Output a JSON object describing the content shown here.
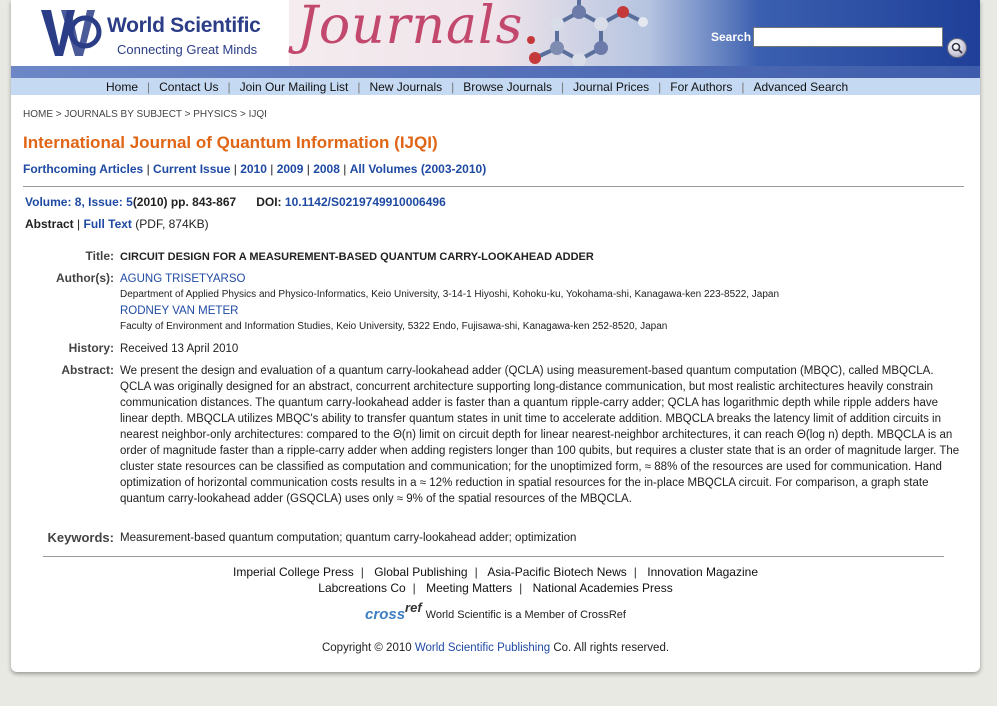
{
  "banner": {
    "logo_title": "World Scientific",
    "logo_tagline": "Connecting Great Minds",
    "journals_word": "Journals",
    "search_label": "Search",
    "search_value": ""
  },
  "nav": [
    "Home",
    "Contact Us",
    "Join Our Mailing List",
    "New Journals",
    "Browse Journals",
    "Journal Prices",
    "For Authors",
    "Advanced Search"
  ],
  "breadcrumb": [
    "HOME",
    "JOURNALS BY SUBJECT",
    "PHYSICS",
    "IJQI"
  ],
  "journal_title": "International Journal of Quantum Information (IJQI)",
  "issue_links": [
    "Forthcoming Articles",
    "Current Issue",
    "2010",
    "2009",
    "2008",
    "All Volumes (2003-2010)"
  ],
  "volume": {
    "vol_issue": "Volume: 8, Issue: 5",
    "year_pages": "(2010) pp. 843-867",
    "doi_label": "DOI:",
    "doi": "10.1142/S0219749910006496"
  },
  "abstract_links": {
    "abstract": "Abstract",
    "full_text": "Full Text",
    "full_text_info": "(PDF, 874KB)"
  },
  "article": {
    "title_label": "Title:",
    "title": "CIRCUIT DESIGN FOR A MEASUREMENT-BASED QUANTUM CARRY-LOOKAHEAD ADDER",
    "authors_label": "Author(s):",
    "authors": [
      {
        "name": "AGUNG TRISETYARSO",
        "affiliation": "Department of Applied Physics and Physico-Informatics, Keio University, 3-14-1 Hiyoshi, Kohoku-ku, Yokohama-shi, Kanagawa-ken 223-8522, Japan"
      },
      {
        "name": "RODNEY VAN METER",
        "affiliation": "Faculty of Environment and Information Studies, Keio University, 5322 Endo, Fujisawa-shi, Kanagawa-ken 252-8520, Japan"
      }
    ],
    "history_label": "History:",
    "history": "Received 13 April 2010",
    "abstract_label": "Abstract:",
    "abstract": "We present the design and evaluation of a quantum carry-lookahead adder (QCLA) using measurement-based quantum computation (MBQC), called MBQCLA. QCLA was originally designed for an abstract, concurrent architecture supporting long-distance communication, but most realistic architectures heavily constrain communication distances. The quantum carry-lookahead adder is faster than a quantum ripple-carry adder; QCLA has logarithmic depth while ripple adders have linear depth. MBQCLA utilizes MBQC's ability to transfer quantum states in unit time to accelerate addition. MBQCLA breaks the latency limit of addition circuits in nearest neighbor-only architectures: compared to the Θ(n) limit on circuit depth for linear nearest-neighbor architectures, it can reach Θ(log n) depth. MBQCLA is an order of magnitude faster than a ripple-carry adder when adding registers longer than 100 qubits, but requires a cluster state that is an order of magnitude larger. The cluster state resources can be classified as computation and communication; for the unoptimized form, ≈ 88% of the resources are used for communication. Hand optimization of horizontal communication costs results in a ≈ 12% reduction in spatial resources for the in-place MBQCLA circuit. For comparison, a graph state quantum carry-lookahead adder (GSQCLA) uses only ≈ 9% of the spatial resources of the MBQCLA.",
    "keywords_label": "Keywords:",
    "keywords": "Measurement-based quantum computation; quantum carry-lookahead adder; optimization"
  },
  "footer": {
    "links_row1": [
      "Imperial College Press",
      "Global Publishing",
      "Asia-Pacific Biotech News",
      "Innovation Magazine"
    ],
    "links_row2": [
      "Labcreations Co",
      "Meeting Matters",
      "National Academies Press"
    ],
    "crossref_logo_a": "cross",
    "crossref_logo_b": "ref",
    "crossref_text": "World Scientific is a Member of CrossRef",
    "copyright_pre": "Copyright © 2010",
    "copyright_link": "World Scientific Publishing",
    "copyright_post": "Co. All rights reserved."
  }
}
